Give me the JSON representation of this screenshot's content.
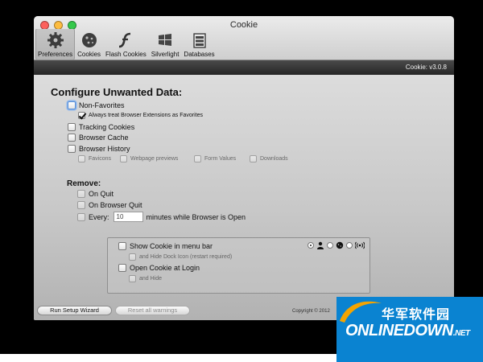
{
  "app": {
    "title": "Cookie",
    "version": "Cookie: v3.0.8"
  },
  "toolbar": {
    "items": [
      {
        "label": "Preferences",
        "icon": "gear-icon",
        "active": true
      },
      {
        "label": "Cookies",
        "icon": "cookie-icon",
        "active": false
      },
      {
        "label": "Flash Cookies",
        "icon": "flash-icon",
        "active": false
      },
      {
        "label": "Silverlight",
        "icon": "silverlight-icon",
        "active": false
      },
      {
        "label": "Databases",
        "icon": "database-icon",
        "active": false
      }
    ]
  },
  "configure": {
    "heading": "Configure Unwanted Data:",
    "non_favorites": {
      "label": "Non-Favorites",
      "checked": false
    },
    "always_treat": {
      "label": "Always treat Browser Extensions as Favorites",
      "checked": true
    },
    "tracking_cookies": {
      "label": "Tracking Cookies",
      "checked": false
    },
    "browser_cache": {
      "label": "Browser Cache",
      "checked": false
    },
    "browser_history": {
      "label": "Browser History",
      "checked": false
    },
    "history_sub": {
      "favicons": "Favicons",
      "webpage_previews": "Webpage previews",
      "form_values": "Form Values",
      "downloads": "Downloads"
    }
  },
  "remove": {
    "heading": "Remove:",
    "on_quit": "On Quit",
    "on_browser_quit": "On Browser Quit",
    "every_label": "Every:",
    "every_value": "10",
    "every_suffix": "minutes while Browser is Open"
  },
  "menu_panel": {
    "show_menu_bar": "Show Cookie in menu bar",
    "hide_dock": "and Hide Dock Icon (restart required)",
    "open_at_login": "Open Cookie at Login",
    "and_hide": "and Hide",
    "selected_radio": 0
  },
  "footer": {
    "run_setup": "Run Setup Wizard",
    "reset_warnings": "Reset all warnings",
    "copyright": "Copyright © 2012"
  },
  "watermark": {
    "chinese": "华军软件园",
    "english": "ONLINEDOWN",
    "suffix": ".NET"
  },
  "colors": {
    "close": "#ff5f57",
    "minimize": "#febc2e",
    "zoom": "#28c840",
    "version_bar": "#2f2f2f",
    "watermark": "#0a83d1"
  }
}
